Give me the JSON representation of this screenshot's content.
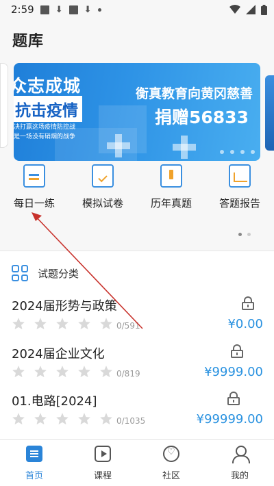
{
  "status_bar": {
    "time": "2:59"
  },
  "page": {
    "title": "题库"
  },
  "banner": {
    "slogan_left_top": "众志成城",
    "slogan_left_main": "抗击疫情",
    "slogan_left_line1": "决打赢这场疫情防控战",
    "slogan_left_line2": "是一场没有硝烟的战争",
    "slogan_right_top": "衡真教育向黄冈慈善",
    "slogan_right_main": "捐赠56833"
  },
  "quick_menu": [
    {
      "label": "每日一练",
      "icon": "daily-practice-icon"
    },
    {
      "label": "模拟试卷",
      "icon": "mock-exam-icon"
    },
    {
      "label": "历年真题",
      "icon": "past-papers-icon"
    },
    {
      "label": "答题报告",
      "icon": "answer-report-icon"
    }
  ],
  "section": {
    "title": "试题分类"
  },
  "question_banks": [
    {
      "name": "2024届形势与政策",
      "progress": "0/591",
      "price": "¥0.00",
      "stars": 0
    },
    {
      "name": "2024届企业文化",
      "progress": "0/819",
      "price": "¥9999.00",
      "stars": 0
    },
    {
      "name": "01.电路[2024]",
      "progress": "0/1035",
      "price": "¥99999.00",
      "stars": 0
    }
  ],
  "bottom_nav": [
    {
      "label": "首页",
      "active": true
    },
    {
      "label": "课程",
      "active": false
    },
    {
      "label": "社区",
      "active": false
    },
    {
      "label": "我的",
      "active": false
    }
  ],
  "colors": {
    "accent": "#2a84d8",
    "price": "#2a92e0",
    "icon_highlight": "#f0a22b",
    "annotation_arrow": "#c8322c"
  }
}
